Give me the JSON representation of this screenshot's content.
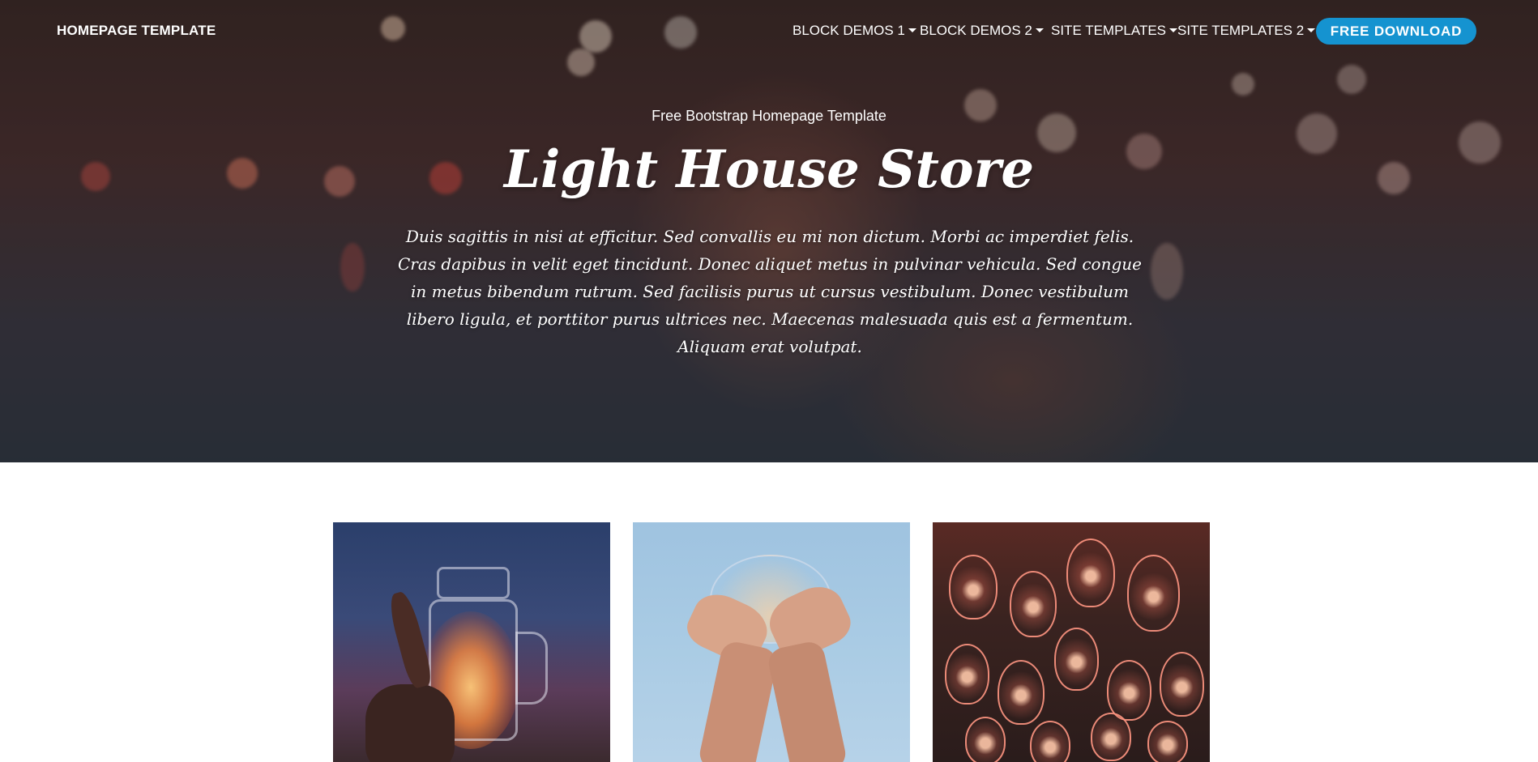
{
  "navbar": {
    "brand": "HOMEPAGE TEMPLATE",
    "items": [
      {
        "label": "BLOCK DEMOS 1"
      },
      {
        "label": "BLOCK DEMOS 2"
      },
      {
        "label": "SITE TEMPLATES"
      },
      {
        "label": "SITE TEMPLATES 2"
      }
    ],
    "cta_label": "FREE DOWNLOAD"
  },
  "hero": {
    "subtitle": "Free Bootstrap Homepage Template",
    "title": "Light House Store",
    "lead": "Duis sagittis in nisi at efficitur. Sed convallis eu mi non dictum. Morbi ac imperdiet felis. Cras dapibus in velit eget tincidunt. Donec aliquet metus in pulvinar vehicula. Sed congue in metus bibendum rutrum. Sed facilisis purus ut cursus vestibulum. Donec vestibulum libero ligula, et porttitor purus ultrices nec. Maecenas malesuada quis est a fermentum. Aliquam erat volutpat."
  },
  "colors": {
    "accent": "#1593d0",
    "text_on_hero": "#ffffff"
  },
  "gallery": [
    {
      "image": "mason-jar-fairy-lights-photo"
    },
    {
      "image": "hands-holding-fairy-lights-photo"
    },
    {
      "image": "hanging-lanterns-photo"
    }
  ]
}
